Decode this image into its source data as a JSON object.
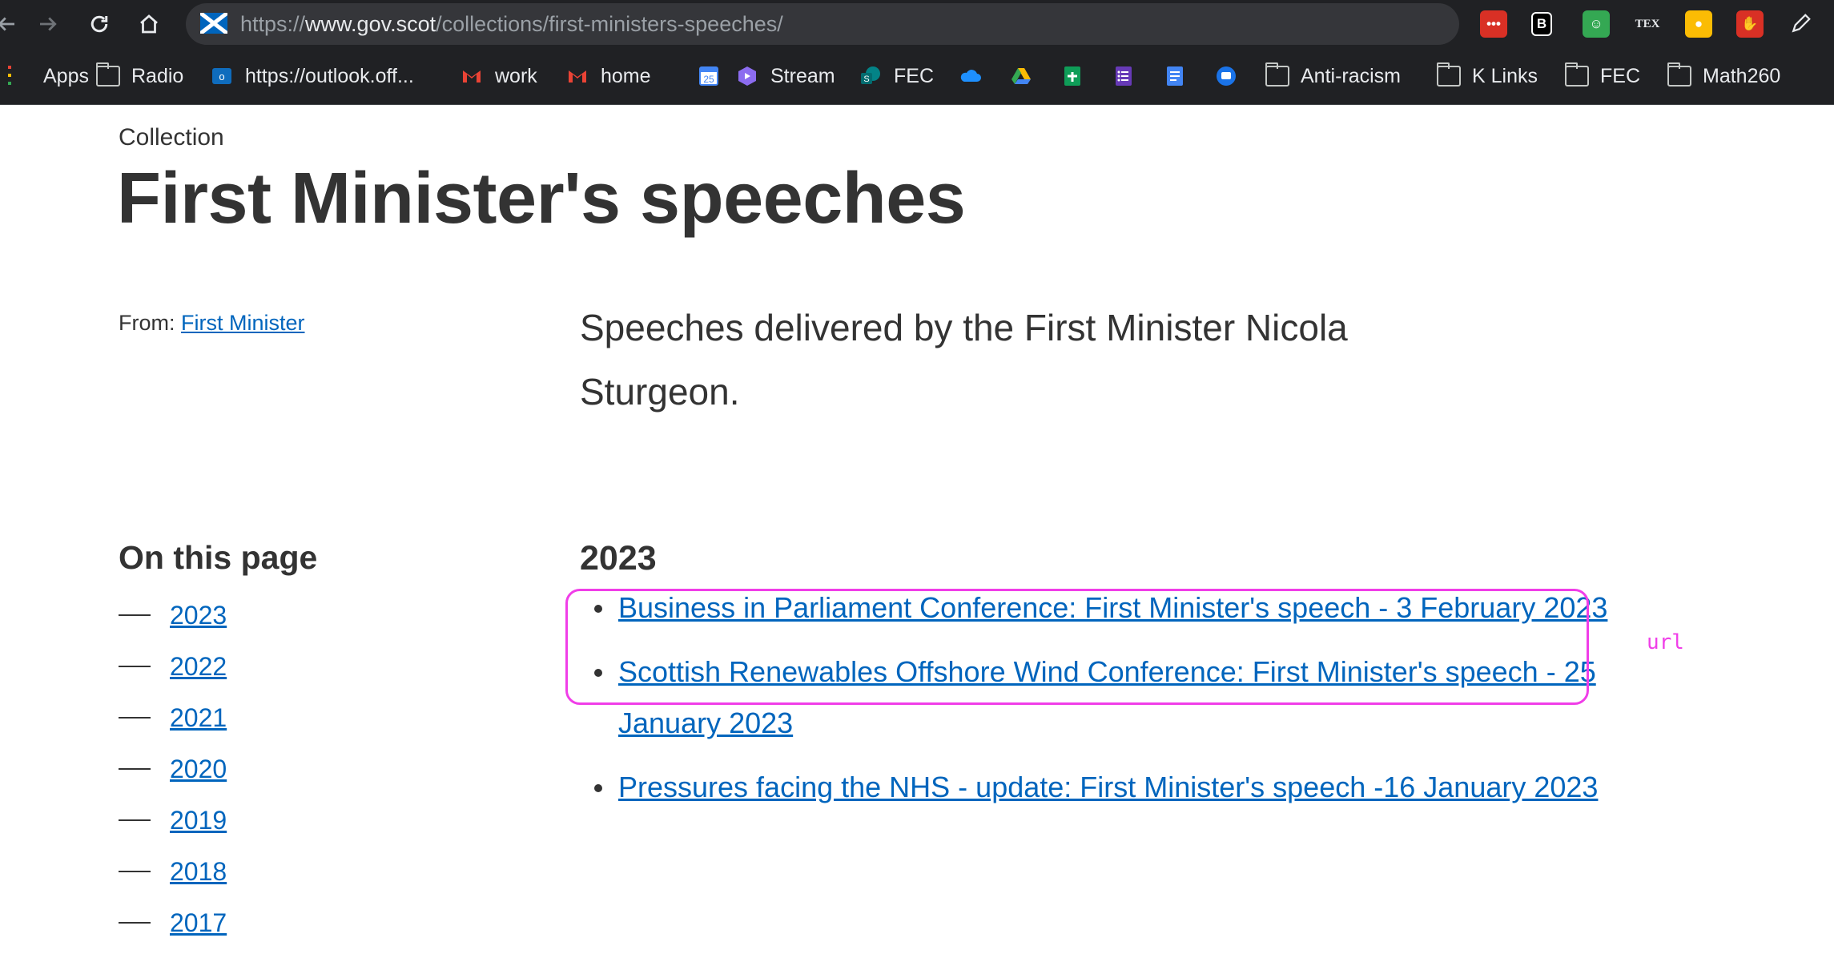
{
  "browser": {
    "url_host_prefix": "https://",
    "url_host": "www.gov.scot",
    "url_path": "/collections/first-ministers-speeches/",
    "bookmarks": [
      {
        "label": "Apps",
        "icon": "apps-grid-icon"
      },
      {
        "label": "Radio",
        "icon": "folder-icon"
      },
      {
        "label": "https://outlook.off...",
        "icon": "outlook-icon"
      },
      {
        "label": "work",
        "icon": "gmail-icon"
      },
      {
        "label": "home",
        "icon": "gmail-icon"
      },
      {
        "label": "",
        "icon": "calendar-icon",
        "icon_text": "25"
      },
      {
        "label": "Stream",
        "icon": "stream-icon"
      },
      {
        "label": "FEC",
        "icon": "sharepoint-icon"
      },
      {
        "label": "",
        "icon": "onedrive-icon"
      },
      {
        "label": "",
        "icon": "drive-icon"
      },
      {
        "label": "",
        "icon": "sheets-icon"
      },
      {
        "label": "",
        "icon": "forms-icon"
      },
      {
        "label": "",
        "icon": "docs-icon"
      },
      {
        "label": "",
        "icon": "chat-icon"
      },
      {
        "label": "Anti-racism",
        "icon": "folder-icon"
      },
      {
        "label": "K Links",
        "icon": "folder-icon"
      },
      {
        "label": "FEC",
        "icon": "folder-icon"
      },
      {
        "label": "Math260",
        "icon": "folder-icon"
      }
    ],
    "extensions": [
      {
        "name": "password-manager-extension-icon",
        "text": "•••",
        "color": "#d93025"
      },
      {
        "name": "notes-extension-icon",
        "text": "B",
        "color": "#000000"
      },
      {
        "name": "smiley-extension-icon",
        "text": "☺",
        "color": "#34a853"
      },
      {
        "name": "tex-extension-icon",
        "text": "TEX",
        "color": "#202124"
      },
      {
        "name": "lightbulb-extension-icon",
        "text": "●",
        "color": "#fbbc04"
      },
      {
        "name": "adblock-extension-icon",
        "text": "✋",
        "color": "#d93025"
      }
    ]
  },
  "page": {
    "kicker": "Collection",
    "title": "First Minister's speeches",
    "from_label": "From: ",
    "from_link": "First Minister",
    "lead": "Speeches delivered by the First Minister Nicola Sturgeon.",
    "sidebar_heading": "On this page",
    "toc": [
      "2023",
      "2022",
      "2021",
      "2020",
      "2019",
      "2018",
      "2017"
    ],
    "section_heading": "2023",
    "speeches": [
      "Business in Parliament Conference: First Minister's speech - 3 February 2023",
      "Scottish Renewables Offshore Wind Conference: First Minister's speech - 25 January 2023",
      "Pressures facing the NHS - update: First Minister's speech -16 January 2023"
    ],
    "annotation": "url",
    "annotation_color": "#f03ee8",
    "link_color": "#0065bd"
  }
}
